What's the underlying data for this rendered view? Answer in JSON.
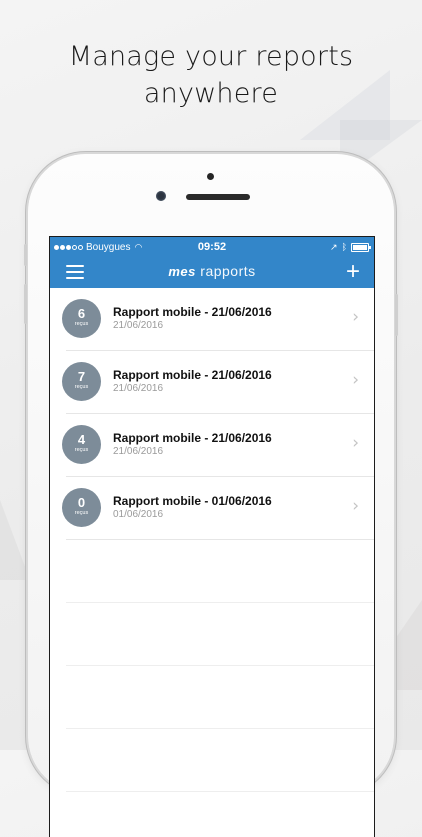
{
  "headline": {
    "line1": "Manage your reports",
    "line2": "anywhere"
  },
  "status_bar": {
    "carrier": "Bouygues",
    "time": "09:52"
  },
  "nav": {
    "title_bold": "mes",
    "title_light": "rapports",
    "menu_icon": "hamburger-icon",
    "add_icon": "plus-icon",
    "add_label": "+"
  },
  "reports": [
    {
      "count": "6",
      "count_label": "reçus",
      "title": "Rapport mobile - 21/06/2016",
      "date": "21/06/2016"
    },
    {
      "count": "7",
      "count_label": "reçus",
      "title": "Rapport mobile - 21/06/2016",
      "date": "21/06/2016"
    },
    {
      "count": "4",
      "count_label": "reçus",
      "title": "Rapport mobile - 21/06/2016",
      "date": "21/06/2016"
    },
    {
      "count": "0",
      "count_label": "reçus",
      "title": "Rapport mobile - 01/06/2016",
      "date": "01/06/2016"
    }
  ],
  "colors": {
    "accent": "#3386c9",
    "badge": "#7d8c99",
    "subtext": "#9a9a9a"
  }
}
